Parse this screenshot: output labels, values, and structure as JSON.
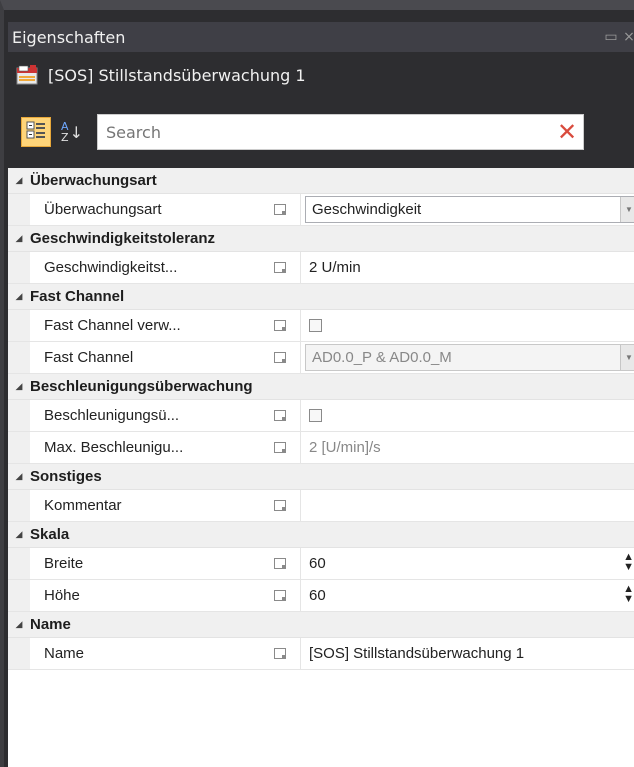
{
  "window": {
    "title": "Eigenschaften",
    "restore_glyph": "▭",
    "close_glyph": "×"
  },
  "object": {
    "name": "[SOS] Stillstandsüberwachung 1",
    "icon": "module-icon"
  },
  "toolbar": {
    "search_placeholder": "Search",
    "sort_label_top": "A",
    "sort_label_bottom": "Z"
  },
  "categories": [
    {
      "name": "Überwachungsart",
      "rows": [
        {
          "label": "Überwachungsart",
          "type": "dropdown",
          "value": "Geschwindigkeit",
          "disabled": false
        }
      ]
    },
    {
      "name": "Geschwindigkeitstoleranz",
      "rows": [
        {
          "label": "Geschwindigkeitst...",
          "type": "text",
          "value": "2 U/min",
          "disabled": false
        }
      ]
    },
    {
      "name": "Fast Channel",
      "rows": [
        {
          "label": "Fast Channel verw...",
          "type": "checkbox",
          "value": "",
          "disabled": false
        },
        {
          "label": "Fast Channel",
          "type": "dropdown",
          "value": "AD0.0_P & AD0.0_M",
          "disabled": true
        }
      ]
    },
    {
      "name": "Beschleunigungsüberwachung",
      "rows": [
        {
          "label": "Beschleunigungsü...",
          "type": "checkbox",
          "value": "",
          "disabled": false
        },
        {
          "label": "Max. Beschleunigu...",
          "type": "text",
          "value": "2 [U/min]/s",
          "disabled": true
        }
      ]
    },
    {
      "name": "Sonstiges",
      "rows": [
        {
          "label": "Kommentar",
          "type": "text",
          "value": "",
          "disabled": false
        }
      ]
    },
    {
      "name": "Skala",
      "rows": [
        {
          "label": "Breite",
          "type": "spinner",
          "value": "60",
          "disabled": false
        },
        {
          "label": "Höhe",
          "type": "spinner",
          "value": "60",
          "disabled": false
        }
      ]
    },
    {
      "name": "Name",
      "rows": [
        {
          "label": "Name",
          "type": "text",
          "value": "[SOS] Stillstandsüberwachung 1",
          "disabled": false
        }
      ]
    }
  ],
  "colors": {
    "accent": "#ffd57a",
    "clear": "#d94b3d",
    "panel_bg": "#2d2d30"
  }
}
